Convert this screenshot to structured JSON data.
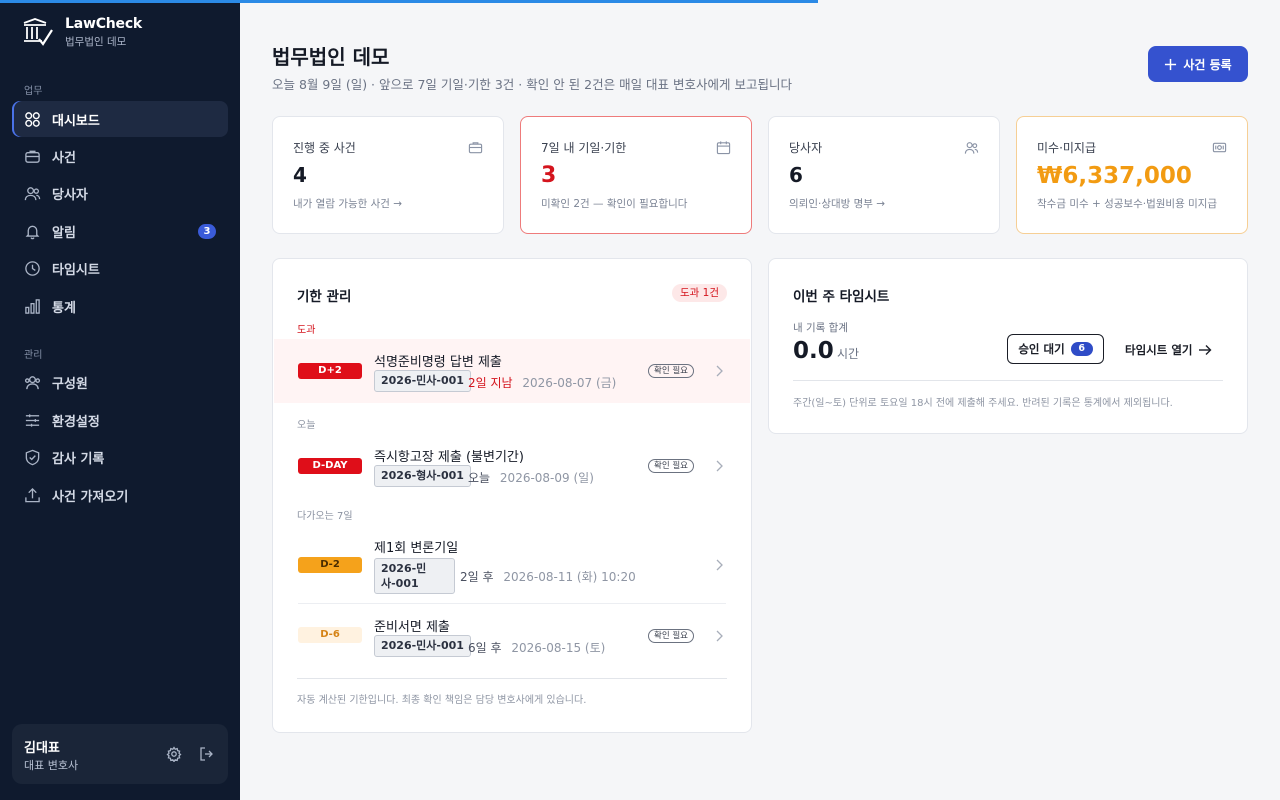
{
  "app": {
    "name": "LawCheck",
    "firm": "법무법인 데모"
  },
  "sidebar": {
    "sections": [
      {
        "label": "업무",
        "items": [
          {
            "label": "대시보드",
            "icon": "grid-icon",
            "active": true
          },
          {
            "label": "사건",
            "icon": "briefcase-icon"
          },
          {
            "label": "당사자",
            "icon": "users-icon"
          },
          {
            "label": "알림",
            "icon": "bell-icon",
            "badge": "3"
          },
          {
            "label": "타임시트",
            "icon": "clock-icon"
          },
          {
            "label": "통계",
            "icon": "bar-chart-icon"
          }
        ]
      },
      {
        "label": "관리",
        "items": [
          {
            "label": "구성원",
            "icon": "team-icon"
          },
          {
            "label": "환경설정",
            "icon": "sliders-icon"
          },
          {
            "label": "감사 기록",
            "icon": "shield-icon"
          },
          {
            "label": "사건 가져오기",
            "icon": "upload-icon"
          }
        ]
      }
    ],
    "user": {
      "name": "김대표",
      "role": "대표 변호사"
    }
  },
  "header": {
    "title": "법무법인 데모",
    "subtitle": "오늘 8월 9일 (일) · 앞으로 7일 기일·기한 3건 · 확인 안 된 2건은 매일 대표 변호사에게 보고됩니다",
    "primary_button": "사건 등록"
  },
  "stats": [
    {
      "label": "진행 중 사건",
      "value": "4",
      "note": "내가 열람 가능한 사건 →",
      "icon": "briefcase-icon"
    },
    {
      "label": "7일 내 기일·기한",
      "value": "3",
      "note": "미확인 2건 — 확인이 필요합니다",
      "icon": "calendar-icon"
    },
    {
      "label": "당사자",
      "value": "6",
      "note": "의뢰인·상대방 명부 →",
      "icon": "users-icon"
    },
    {
      "label": "미수·미지급",
      "value": "₩6,337,000",
      "note": "착수금 미수 + 성공보수·법원비용 미지급",
      "icon": "cash-icon"
    }
  ],
  "deadlines": {
    "title": "기한 관리",
    "overdue_badge": "도과 1건",
    "groups": {
      "overdue": "도과",
      "today": "오늘",
      "upcoming": "다가오는 7일"
    },
    "items": [
      {
        "dday": "D+2",
        "title": "석명준비명령 답변 제출",
        "case": "2026-민사-001",
        "lead": "2일 지남",
        "date": "2026-08-07 (금)",
        "tag": "확인 필요"
      },
      {
        "dday": "D-DAY",
        "title": "즉시항고장 제출 (불변기간)",
        "case": "2026-형사-001",
        "lead": "오늘",
        "date": "2026-08-09 (일)",
        "tag": "확인 필요"
      },
      {
        "dday": "D-2",
        "title": "제1회 변론기일",
        "case": "2026-민사-001",
        "lead": "2일 후",
        "date": "2026-08-11 (화) 10:20"
      },
      {
        "dday": "D-6",
        "title": "준비서면 제출",
        "case": "2026-민사-001",
        "lead": "6일 후",
        "date": "2026-08-15 (토)",
        "tag": "확인 필요"
      }
    ],
    "footnote": "자동 계산된 기한입니다. 최종 확인 책임은 담당 변호사에게 있습니다."
  },
  "timesheet": {
    "title": "이번 주 타임시트",
    "total_label": "내 기록 합계",
    "total_value": "0.0",
    "unit": "시간",
    "approve_label": "승인 대기",
    "approve_count": "6",
    "open_label": "타임시트 열기",
    "note": "주간(일~토) 단위로 토요일 18시 전에 제출해 주세요. 반려된 기록은 통계에서 제외됩니다."
  },
  "colors": {
    "sidebar_bg": "#0f1a2e",
    "primary": "#3552cf",
    "danger": "#d4141d",
    "warning": "#f29b12",
    "progress": "#2b8ae6"
  }
}
